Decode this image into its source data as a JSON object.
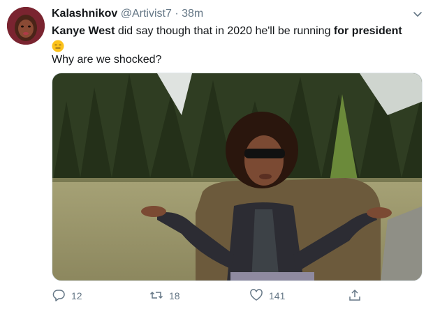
{
  "tweet": {
    "display_name": "Kalashnikov",
    "handle": "@Artivist7",
    "separator": "·",
    "time": "38m",
    "text_part1": "Kanye West",
    "text_part2": " did say though that in 2020 he'll be running ",
    "text_part3": "for president",
    "emoji": "expressionless-face-emoji",
    "text_line2": "Why are we shocked?"
  },
  "actions": {
    "reply_count": "12",
    "retweet_count": "18",
    "like_count": "141"
  },
  "icons": {
    "reply": "reply-icon",
    "retweet": "retweet-icon",
    "like": "like-icon",
    "share": "share-icon",
    "caret": "chevron-down-icon"
  },
  "colors": {
    "secondary_text": "#657786",
    "primary_text": "#14171a",
    "border": "#e1e8ed"
  }
}
